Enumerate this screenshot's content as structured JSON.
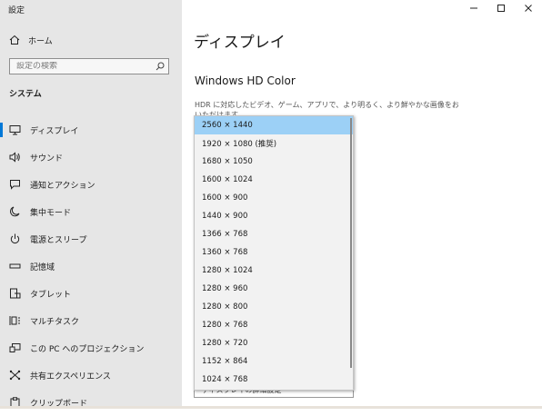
{
  "window": {
    "title": "設定",
    "minimize": "minimize",
    "maximize": "maximize",
    "close": "close"
  },
  "sidebar": {
    "home": "ホーム",
    "search_placeholder": "設定の検索",
    "section": "システム",
    "items": [
      {
        "label": "ディスプレイ",
        "icon": "monitor-icon",
        "active": true
      },
      {
        "label": "サウンド",
        "icon": "speaker-icon"
      },
      {
        "label": "通知とアクション",
        "icon": "message-icon"
      },
      {
        "label": "集中モード",
        "icon": "moon-icon"
      },
      {
        "label": "電源とスリープ",
        "icon": "power-icon"
      },
      {
        "label": "記憶域",
        "icon": "storage-icon"
      },
      {
        "label": "タブレット",
        "icon": "tablet-icon"
      },
      {
        "label": "マルチタスク",
        "icon": "multitask-icon"
      },
      {
        "label": "この PC へのプロジェクション",
        "icon": "projection-icon"
      },
      {
        "label": "共有エクスペリエンス",
        "icon": "shared-icon"
      },
      {
        "label": "クリップボード",
        "icon": "clipboard-icon"
      }
    ]
  },
  "main": {
    "title": "ディスプレイ",
    "hd_color_title": "Windows HD Color",
    "description_line1": "HDR に対応したビデオ、ゲーム、アプリで、より明るく、より鮮やかな画像をお楽しみ",
    "description_line2": "いただけます。",
    "behind_text": "ディスプレイの詳細設定",
    "resolution_options": [
      "2560 × 1440",
      "1920 × 1080 (推奨)",
      "1680 × 1050",
      "1600 × 1024",
      "1600 × 900",
      "1440 × 900",
      "1366 × 768",
      "1360 × 768",
      "1280 × 1024",
      "1280 × 960",
      "1280 × 800",
      "1280 × 768",
      "1280 × 720",
      "1152 × 864",
      "1024 × 768"
    ],
    "selected_index": 0
  },
  "colors": {
    "accent": "#0078d7",
    "selection": "#9cd0f6",
    "sidebar_bg": "#e6e6e6"
  }
}
